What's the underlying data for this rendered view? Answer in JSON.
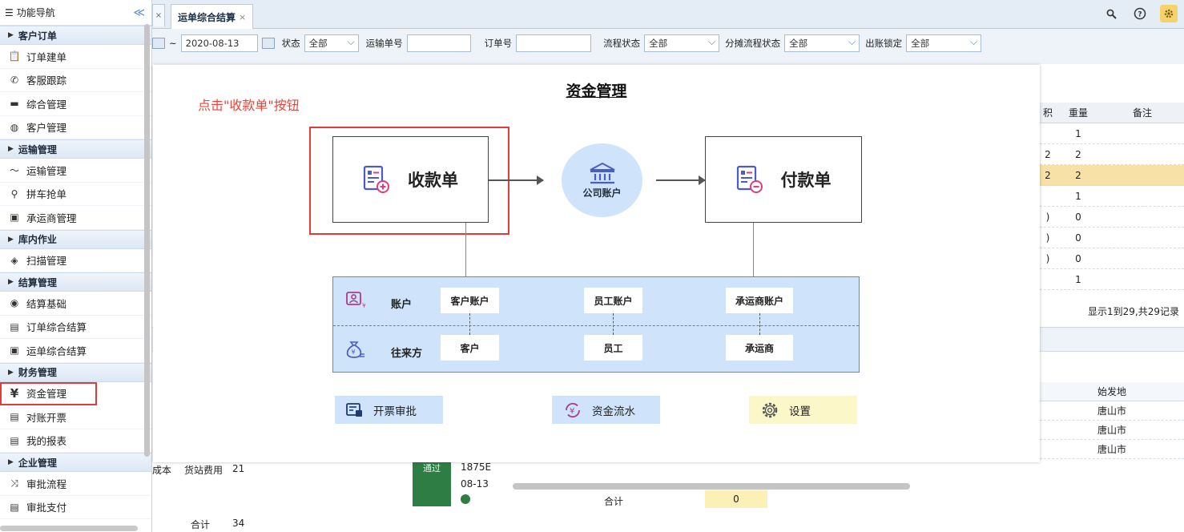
{
  "sidebar": {
    "title": "功能导航",
    "collapse_glyph": "≪",
    "sections": [
      {
        "label": "客户订单",
        "items": [
          {
            "label": "订单建单",
            "icon": "clipboard-icon",
            "glyph": "📋"
          },
          {
            "label": "客服跟踪",
            "icon": "phone-icon",
            "glyph": "✆"
          },
          {
            "label": "综合管理",
            "icon": "card-icon",
            "glyph": "▬"
          },
          {
            "label": "客户管理",
            "icon": "user-icon",
            "glyph": "◍"
          }
        ]
      },
      {
        "label": "运输管理",
        "items": [
          {
            "label": "运输管理",
            "icon": "route-icon",
            "glyph": "〜"
          },
          {
            "label": "拼车抢单",
            "icon": "pin-icon",
            "glyph": "⚲"
          },
          {
            "label": "承运商管理",
            "icon": "carrier-icon",
            "glyph": "▣"
          }
        ]
      },
      {
        "label": "库内作业",
        "items": [
          {
            "label": "扫描管理",
            "icon": "cube-icon",
            "glyph": "◈"
          }
        ]
      },
      {
        "label": "结算管理",
        "items": [
          {
            "label": "结算基础",
            "icon": "eye-icon",
            "glyph": "◉"
          },
          {
            "label": "订单综合结算",
            "icon": "document-icon",
            "glyph": "▤"
          },
          {
            "label": "运单综合结算",
            "icon": "document-icon",
            "glyph": "▣"
          }
        ]
      },
      {
        "label": "财务管理",
        "items": [
          {
            "label": "资金管理",
            "icon": "yen-icon",
            "glyph": "¥",
            "active": true
          },
          {
            "label": "对账开票",
            "icon": "document-icon",
            "glyph": "▤"
          },
          {
            "label": "我的报表",
            "icon": "document-icon",
            "glyph": "▤"
          }
        ]
      },
      {
        "label": "企业管理",
        "items": [
          {
            "label": "审批流程",
            "icon": "shuffle-icon",
            "glyph": "⤨"
          },
          {
            "label": "审批支付",
            "icon": "document-icon",
            "glyph": "▤"
          }
        ]
      }
    ]
  },
  "tabs": {
    "active_label": "运单综合结算",
    "close_glyph": "×"
  },
  "toolbar_icons": [
    "search-icon",
    "help-icon",
    "settings-icon"
  ],
  "filters": {
    "date_prefix": "~",
    "date_value": "2020-08-13",
    "status_label": "状态",
    "status_value": "全部",
    "waybill_label": "运输单号",
    "order_label": "订单号",
    "flow_status_label": "流程状态",
    "flow_status_value": "全部",
    "alloc_status_label": "分摊流程状态",
    "alloc_status_value": "全部",
    "lock_label": "出账锁定",
    "lock_value": "全部"
  },
  "grid": {
    "headers": [
      "积",
      "重量",
      "备注"
    ],
    "rows": [
      {
        "a": "",
        "b": "1"
      },
      {
        "a": "2",
        "b": "2"
      },
      {
        "a": "2",
        "b": "2",
        "selected": true
      },
      {
        "a": "",
        "b": "1"
      },
      {
        "a": ")",
        "b": "0"
      },
      {
        "a": ")",
        "b": "0"
      },
      {
        "a": ")",
        "b": "0"
      },
      {
        "a": "",
        "b": "1"
      }
    ],
    "paging_text": "显示1到29,共29记录"
  },
  "lower": {
    "right_header": "始发地",
    "right_rows": [
      "唐山市",
      "唐山市",
      "唐山市"
    ],
    "left_cells": [
      "成本",
      "货站费用",
      "21"
    ],
    "left_total_label": "合计",
    "left_total_value": "34",
    "status_text": "通过",
    "phone_fragment": "1875E",
    "date_fragment": "08-13",
    "sum_label": "合计",
    "sum_value": "0"
  },
  "modal": {
    "title": "资金管理",
    "hint": "点击\"收款单\"按钮",
    "receipt_label": "收款单",
    "payment_label": "付款单",
    "company_account_label": "公司账户",
    "accounts_row_label": "账户",
    "counterparty_row_label": "往来方",
    "account_chips": [
      "客户账户",
      "员工账户",
      "承运商账户"
    ],
    "counterparty_chips": [
      "客户",
      "员工",
      "承运商"
    ],
    "actions": [
      {
        "label": "开票审批",
        "icon": "invoice-icon"
      },
      {
        "label": "资金流水",
        "icon": "cashflow-icon"
      },
      {
        "label": "设置",
        "icon": "gear-icon"
      }
    ]
  }
}
